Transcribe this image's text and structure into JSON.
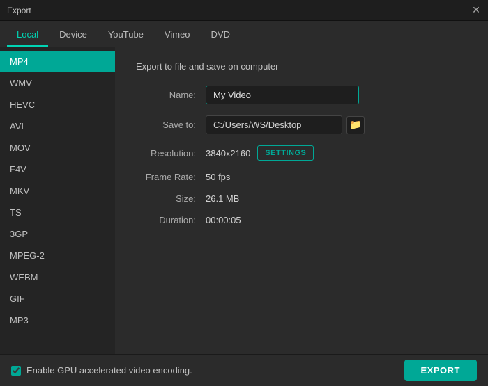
{
  "window": {
    "title": "Export",
    "close_label": "✕"
  },
  "tabs": [
    {
      "id": "local",
      "label": "Local",
      "active": true
    },
    {
      "id": "device",
      "label": "Device",
      "active": false
    },
    {
      "id": "youtube",
      "label": "YouTube",
      "active": false
    },
    {
      "id": "vimeo",
      "label": "Vimeo",
      "active": false
    },
    {
      "id": "dvd",
      "label": "DVD",
      "active": false
    }
  ],
  "sidebar": {
    "items": [
      {
        "id": "mp4",
        "label": "MP4",
        "active": true
      },
      {
        "id": "wmv",
        "label": "WMV",
        "active": false
      },
      {
        "id": "hevc",
        "label": "HEVC",
        "active": false
      },
      {
        "id": "avi",
        "label": "AVI",
        "active": false
      },
      {
        "id": "mov",
        "label": "MOV",
        "active": false
      },
      {
        "id": "f4v",
        "label": "F4V",
        "active": false
      },
      {
        "id": "mkv",
        "label": "MKV",
        "active": false
      },
      {
        "id": "ts",
        "label": "TS",
        "active": false
      },
      {
        "id": "3gp",
        "label": "3GP",
        "active": false
      },
      {
        "id": "mpeg2",
        "label": "MPEG-2",
        "active": false
      },
      {
        "id": "webm",
        "label": "WEBM",
        "active": false
      },
      {
        "id": "gif",
        "label": "GIF",
        "active": false
      },
      {
        "id": "mp3",
        "label": "MP3",
        "active": false
      }
    ]
  },
  "panel": {
    "title": "Export to file and save on computer",
    "name_label": "Name:",
    "name_value": "My Video",
    "saveto_label": "Save to:",
    "saveto_value": "C:/Users/WS/Desktop",
    "folder_icon": "🗁",
    "resolution_label": "Resolution:",
    "resolution_value": "3840x2160",
    "settings_label": "SETTINGS",
    "framerate_label": "Frame Rate:",
    "framerate_value": "50 fps",
    "size_label": "Size:",
    "size_value": "26.1 MB",
    "duration_label": "Duration:",
    "duration_value": "00:00:05"
  },
  "bottom": {
    "gpu_label": "Enable GPU accelerated video encoding.",
    "export_label": "EXPORT"
  }
}
